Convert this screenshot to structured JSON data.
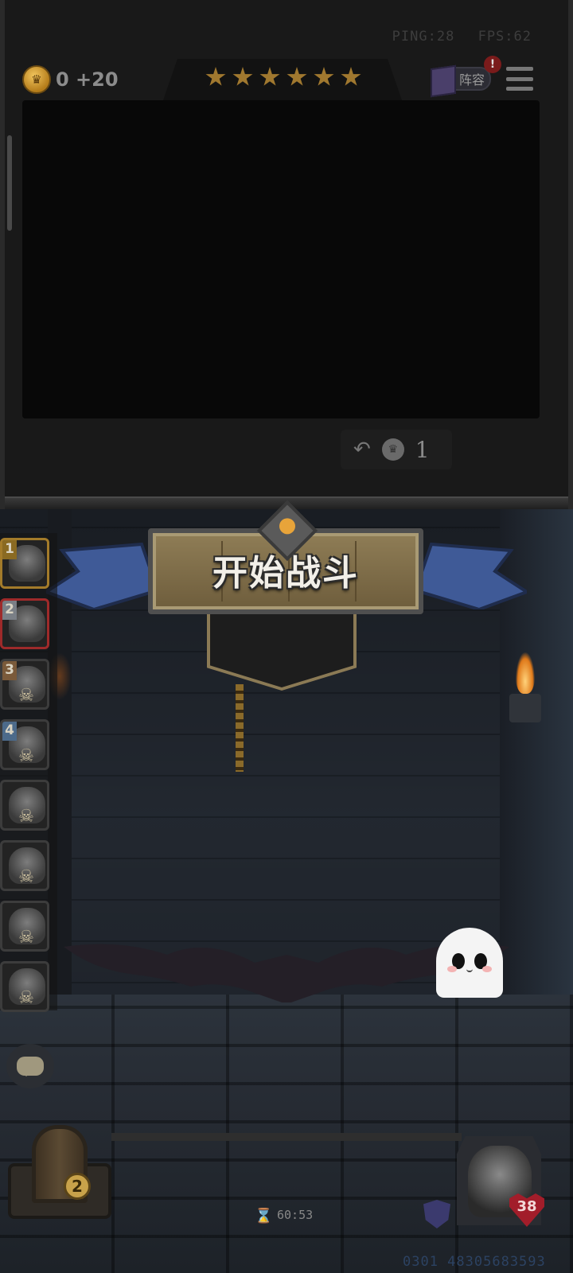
{
  "hud": {
    "ping": "PING:28",
    "fps": "FPS:62",
    "coins": "0 +20",
    "star_count": 6,
    "lineup_label": "阵容",
    "alert": "!"
  },
  "board": {
    "refresh_cost": "1"
  },
  "battle": {
    "start_label": "开始战斗"
  },
  "heroes": [
    {
      "rank": "1",
      "selected": "gold",
      "has_skull": false
    },
    {
      "rank": "2",
      "selected": "red",
      "has_skull": false
    },
    {
      "rank": "3",
      "selected": "none",
      "has_skull": true
    },
    {
      "rank": "4",
      "selected": "none",
      "has_skull": true
    },
    {
      "rank": "",
      "selected": "none",
      "has_skull": true
    },
    {
      "rank": "",
      "selected": "none",
      "has_skull": true
    },
    {
      "rank": "",
      "selected": "none",
      "has_skull": true
    },
    {
      "rank": "",
      "selected": "none",
      "has_skull": true
    }
  ],
  "bottom": {
    "door_count": "2",
    "timer": "60:53",
    "hp": "38",
    "player_id": "0301 48305683593"
  },
  "colors": {
    "star": "#a0782f",
    "banner_ribbon": "#3f5a97",
    "hp_badge": "#a21d2a"
  },
  "icons": {
    "coin": "coin-icon",
    "refresh": "refresh-icon",
    "chat": "chat-icon",
    "timer": "hourglass-icon",
    "shield": "shield-icon"
  }
}
